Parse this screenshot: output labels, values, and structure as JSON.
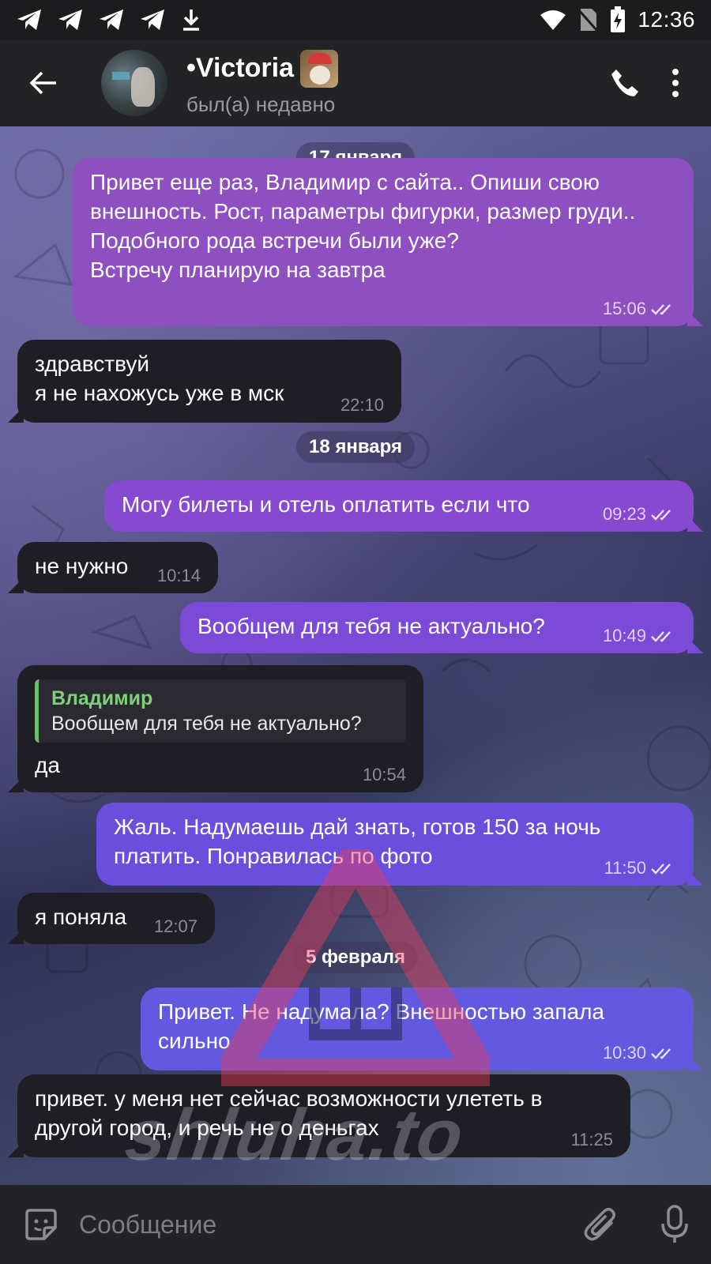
{
  "status_bar": {
    "time": "12:36"
  },
  "header": {
    "title": "•Victoria",
    "status": "был(а) недавно"
  },
  "dates": {
    "d1": "17 января",
    "d2": "18 января",
    "d3": "5 февраля"
  },
  "messages": [
    {
      "dir": "out",
      "text": "Привет еще раз, Владимир с сайта.. Опиши свою внешность. Рост, параметры фигурки, размер груди..\nПодобного рода встречи были уже?\nВстречу планирую на завтра",
      "time": "15:06"
    },
    {
      "dir": "in",
      "text": "здравствуй\nя не нахожусь уже в мск",
      "time": "22:10"
    },
    {
      "dir": "out",
      "text": "Могу билеты и отель оплатить если что",
      "time": "09:23"
    },
    {
      "dir": "in",
      "text": "не нужно",
      "time": "10:14"
    },
    {
      "dir": "out",
      "text": "Вообщем для тебя не актуально?",
      "time": "10:49"
    },
    {
      "dir": "in",
      "reply_name": "Владимир",
      "reply_text": "Вообщем для тебя не актуально?",
      "text": "да",
      "time": "10:54"
    },
    {
      "dir": "out",
      "text": "Жаль. Надумаешь дай знать, готов 150 за ночь платить. Понравилась по фото",
      "time": "11:50"
    },
    {
      "dir": "in",
      "text": "я поняла",
      "time": "12:07"
    },
    {
      "dir": "out",
      "text": "Привет. Не надумала? Внешностью запала сильно",
      "time": "10:30"
    },
    {
      "dir": "in",
      "text": "привет. у меня нет сейчас возможности улететь в другой город, и речь не о деньгах",
      "time": "11:25"
    }
  ],
  "watermark": {
    "text": "shluha.to"
  },
  "input": {
    "placeholder": "Сообщение"
  },
  "colors": {
    "accent_out": "#8e4fc1",
    "incoming": "#1f1e24",
    "reply_name": "#7fd07b"
  }
}
